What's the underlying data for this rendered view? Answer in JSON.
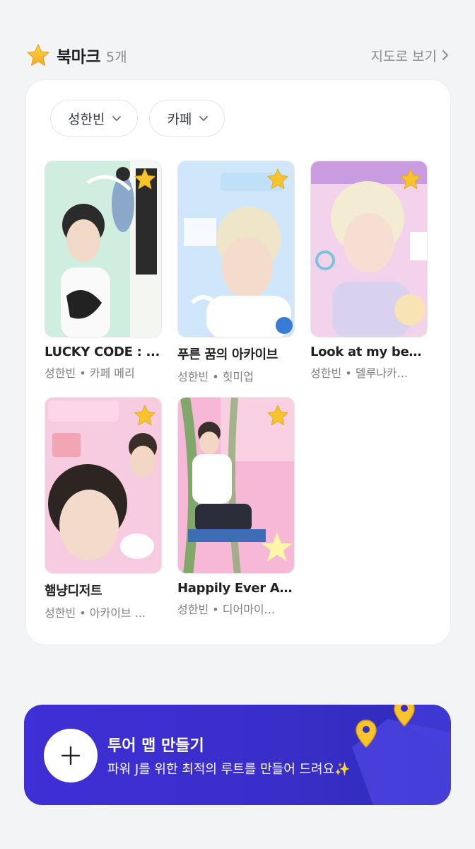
{
  "header": {
    "icon": "star-icon",
    "title": "북마크",
    "count": "5개",
    "map_link": "지도로 보기"
  },
  "filters": [
    {
      "label": "성한빈"
    },
    {
      "label": "카페"
    }
  ],
  "bookmarks": [
    {
      "title": "LUCKY CODE : ...",
      "meta": "성한빈 • 카페 메리",
      "bg": "#cfeee0"
    },
    {
      "title": "푸른 꿈의 아카이브",
      "meta": "성한빈 • 힛미업",
      "bg": "#cfe6fb"
    },
    {
      "title": "Look at my bee...",
      "meta": "성한빈 • 델루나카...",
      "bg": "#f3d3ec"
    },
    {
      "title": "햄냥디저트",
      "meta": "성한빈 • 아카이브 ...",
      "bg": "#f7cbe0"
    },
    {
      "title": "Happily Ever Af...",
      "meta": "성한빈 • 디어마이...",
      "bg": "#f6b8d6"
    }
  ],
  "banner": {
    "title": "투어 맵 만들기",
    "subtitle": "파워 J를 위한 최적의 루트를 만들어 드려요✨",
    "icon": "plus-icon",
    "colors": {
      "start": "#3e2fd6",
      "end": "#2d2cb8"
    }
  },
  "colors": {
    "star": "#f7c52b",
    "accent": "#3e2fd6"
  }
}
